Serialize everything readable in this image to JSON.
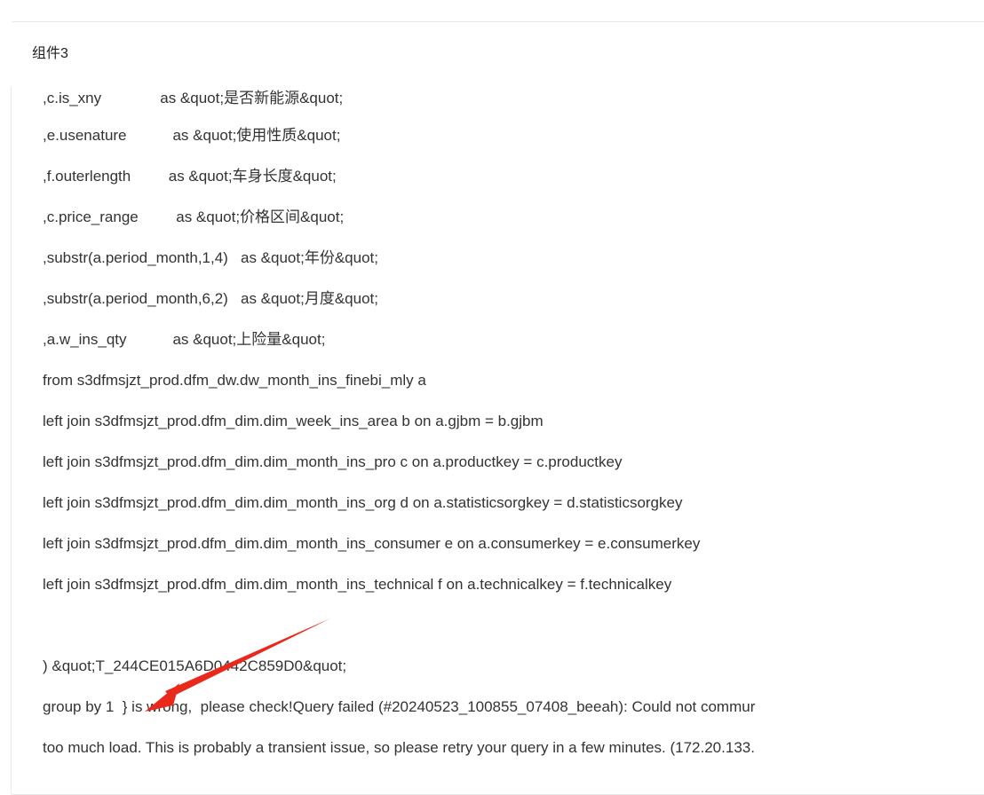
{
  "panel": {
    "title": "组件3"
  },
  "code": {
    "lines": [
      ",c.is_xny              as &quot;是否新能源&quot;",
      ",e.usenature           as &quot;使用性质&quot;",
      ",f.outerlength         as &quot;车身长度&quot;",
      ",c.price_range         as &quot;价格区间&quot;",
      ",substr(a.period_month,1,4)   as &quot;年份&quot;",
      ",substr(a.period_month,6,2)   as &quot;月度&quot;",
      ",a.w_ins_qty           as &quot;上险量&quot;",
      "from s3dfmsjzt_prod.dfm_dw.dw_month_ins_finebi_mly a",
      "left join s3dfmsjzt_prod.dfm_dim.dim_week_ins_area b on a.gjbm = b.gjbm",
      "left join s3dfmsjzt_prod.dfm_dim.dim_month_ins_pro c on a.productkey = c.productkey",
      "left join s3dfmsjzt_prod.dfm_dim.dim_month_ins_org d on a.statisticsorgkey = d.statisticsorgkey",
      "left join s3dfmsjzt_prod.dfm_dim.dim_month_ins_consumer e on a.consumerkey = e.consumerkey",
      "left join s3dfmsjzt_prod.dfm_dim.dim_month_ins_technical f on a.technicalkey = f.technicalkey",
      "",
      ") &quot;T_244CE015A6D0442C859D0&quot;",
      "group by 1  } is wrong,  please check!Query failed (#20240523_100855_07408_beeah): Could not commur",
      "too much load. This is probably a transient issue, so please retry your query in a few minutes. (172.20.133."
    ]
  },
  "colors": {
    "text": "#333333",
    "border": "#e6e8eb",
    "arrow": "#e8291c"
  },
  "annotation": {
    "type": "arrow",
    "icon": "red-arrow-icon"
  }
}
